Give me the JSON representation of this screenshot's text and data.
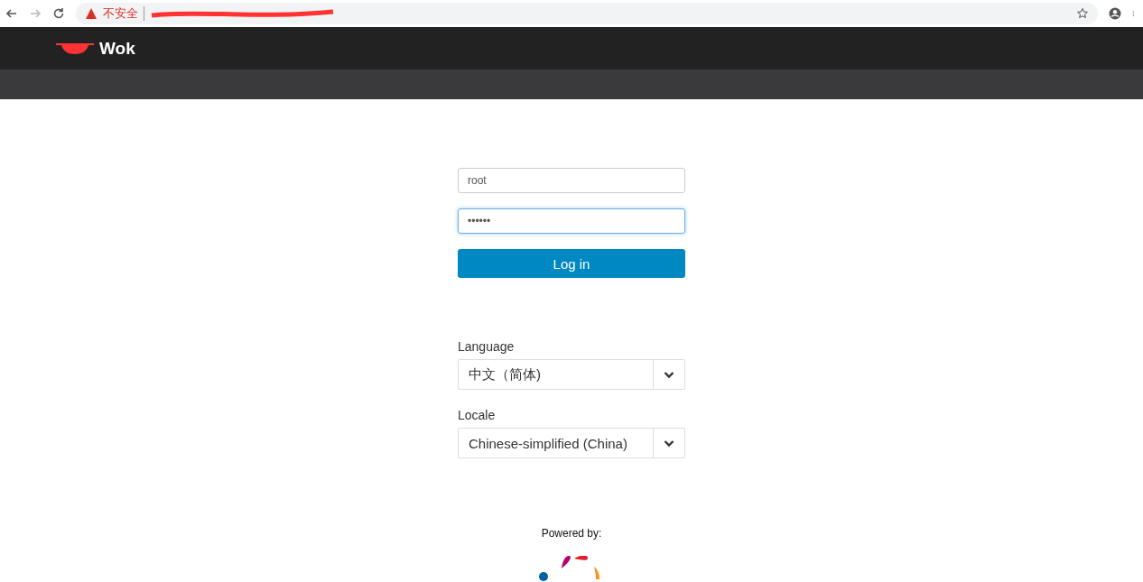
{
  "browser": {
    "security_label": "不安全"
  },
  "header": {
    "brand": "Wok"
  },
  "login": {
    "username": {
      "value": "root",
      "focused": false
    },
    "password": {
      "value": "••••••",
      "focused": true
    },
    "submit": "Log in"
  },
  "settings": [
    {
      "label": "Language",
      "value": "中文（简体)"
    },
    {
      "label": "Locale",
      "value": "Chinese-simplified (China)"
    }
  ],
  "footer": {
    "powered_by": "Powered by:"
  }
}
